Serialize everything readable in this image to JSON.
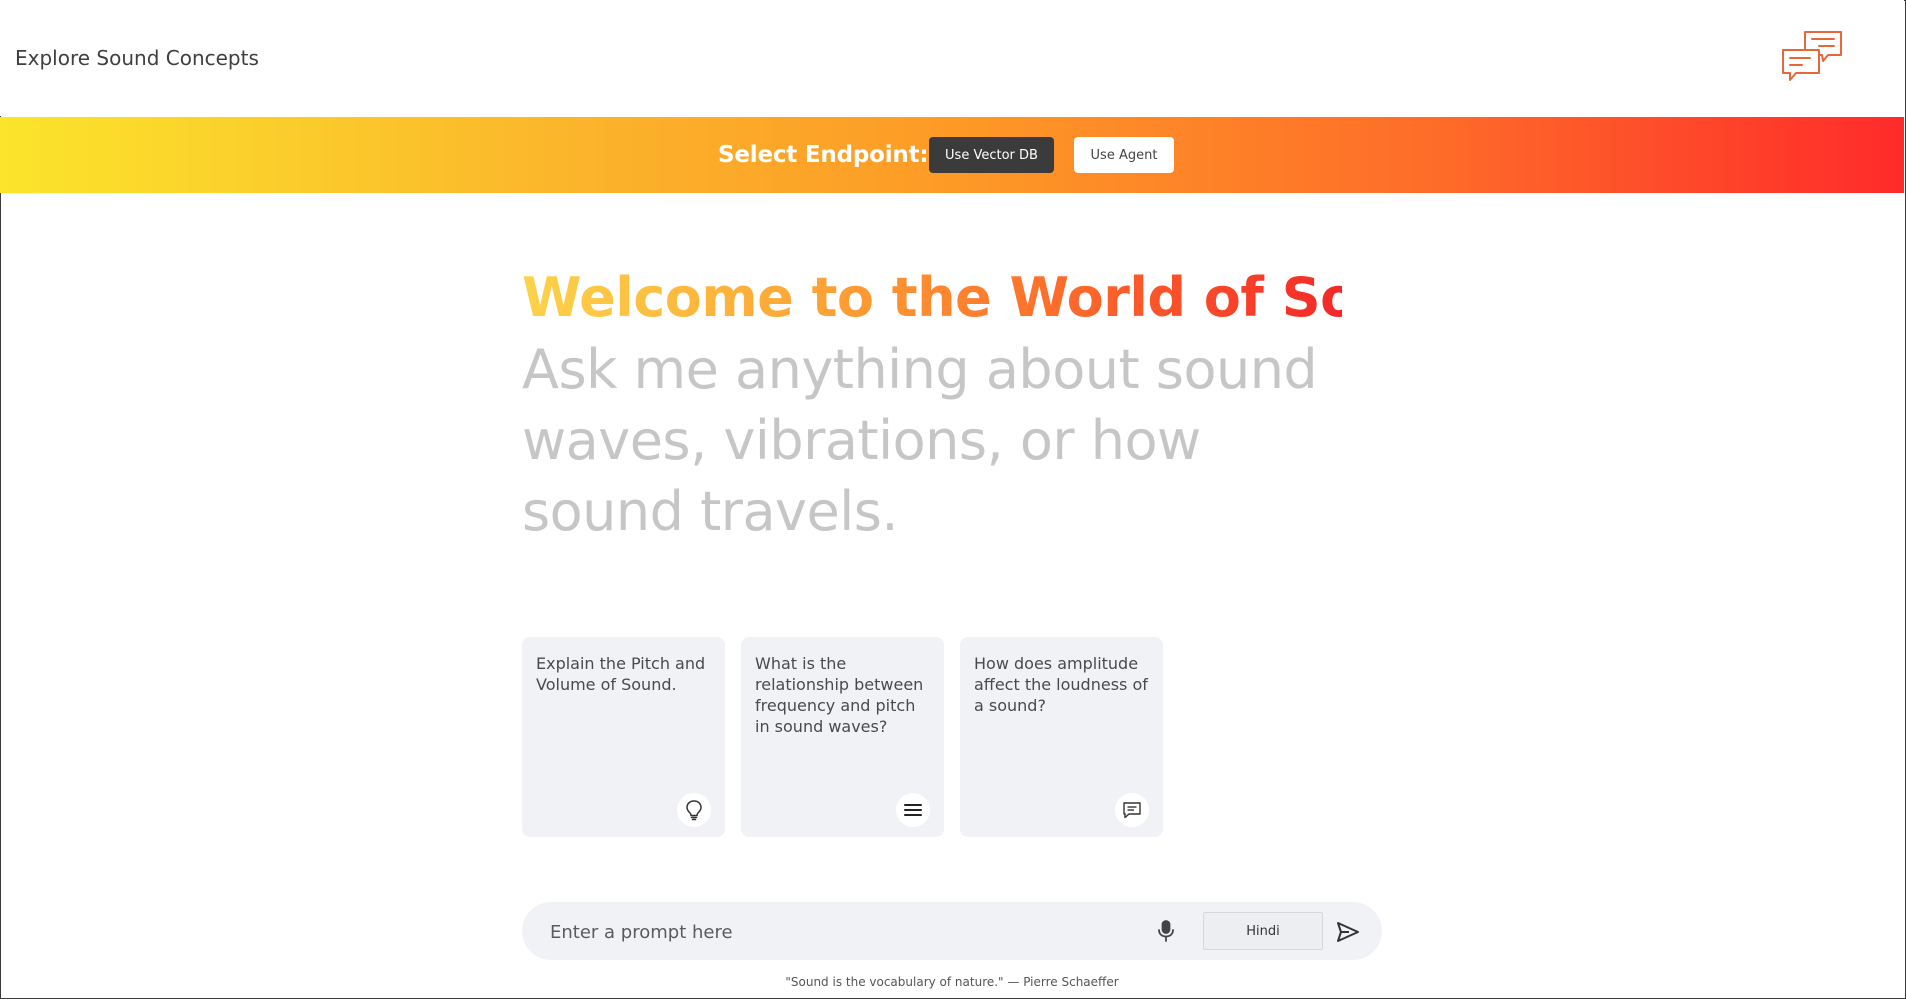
{
  "header": {
    "title": "Explore Sound Concepts",
    "logo_icon": "chat-bubbles-icon",
    "logo_color": "#e8673a"
  },
  "endpoint": {
    "label": "Select Endpoint:",
    "vector_db_button": "Use Vector DB",
    "agent_button": "Use Agent",
    "selected": "Use Vector DB"
  },
  "hero": {
    "title": "Welcome to the World of Sound!",
    "subtitle": "Ask me anything about sound waves, vibrations, or how sound travels."
  },
  "cards": [
    {
      "text": "Explain the Pitch and Volume of Sound.",
      "icon": "lightbulb-icon"
    },
    {
      "text": "What is the relationship between frequency and pitch in sound waves?",
      "icon": "menu-lines-icon"
    },
    {
      "text": "How does amplitude affect the loudness of a sound?",
      "icon": "message-icon"
    }
  ],
  "prompt": {
    "placeholder": "Enter a prompt here",
    "value": "",
    "language": "Hindi",
    "mic_icon": "microphone-icon",
    "send_icon": "send-icon"
  },
  "footer": {
    "quote": "\"Sound is the vocabulary of nature.\" — Pierre Schaeffer"
  },
  "colors": {
    "gradient_start": "#fbe42b",
    "gradient_end": "#ff2a2a",
    "dark_button": "#3b3b3b",
    "card_bg": "#f0f2f6"
  }
}
